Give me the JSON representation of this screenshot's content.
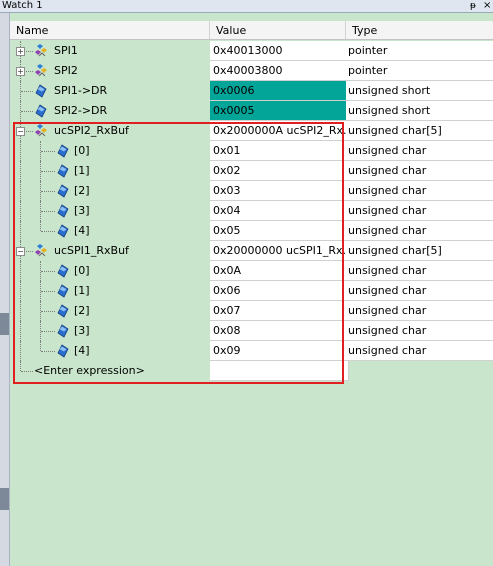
{
  "window": {
    "title": "Watch 1",
    "pin_icon": "pin-icon",
    "close_icon": "close-icon",
    "pin_glyph": "ᵽ",
    "close_glyph": "×"
  },
  "columns": {
    "name": "Name",
    "value": "Value",
    "type": "Type"
  },
  "rows": [
    {
      "name": "SPI1",
      "value": "0x40013000",
      "type": "pointer",
      "icon": "struct-icon",
      "expander": "+"
    },
    {
      "name": "SPI2",
      "value": "0x40003800",
      "type": "pointer",
      "icon": "struct-icon",
      "expander": "+"
    },
    {
      "name": "SPI1->DR",
      "value": "0x0006",
      "type": "unsigned short",
      "icon": "variable-icon",
      "highlight": true
    },
    {
      "name": "SPI2->DR",
      "value": "0x0005",
      "type": "unsigned short",
      "icon": "variable-icon",
      "highlight": true
    },
    {
      "name": "ucSPI2_RxBuf",
      "value": "0x2000000A ucSPI2_Rx...",
      "type": "unsigned char[5]",
      "icon": "struct-icon",
      "expander": "−"
    },
    {
      "name": "[0]",
      "value": "0x01",
      "type": "unsigned char",
      "icon": "variable-icon"
    },
    {
      "name": "[1]",
      "value": "0x02",
      "type": "unsigned char",
      "icon": "variable-icon"
    },
    {
      "name": "[2]",
      "value": "0x03",
      "type": "unsigned char",
      "icon": "variable-icon"
    },
    {
      "name": "[3]",
      "value": "0x04",
      "type": "unsigned char",
      "icon": "variable-icon"
    },
    {
      "name": "[4]",
      "value": "0x05",
      "type": "unsigned char",
      "icon": "variable-icon"
    },
    {
      "name": "ucSPI1_RxBuf",
      "value": "0x20000000 ucSPI1_Rx...",
      "type": "unsigned char[5]",
      "icon": "struct-icon",
      "expander": "−"
    },
    {
      "name": "[0]",
      "value": "0x0A",
      "type": "unsigned char",
      "icon": "variable-icon"
    },
    {
      "name": "[1]",
      "value": "0x06",
      "type": "unsigned char",
      "icon": "variable-icon"
    },
    {
      "name": "[2]",
      "value": "0x07",
      "type": "unsigned char",
      "icon": "variable-icon"
    },
    {
      "name": "[3]",
      "value": "0x08",
      "type": "unsigned char",
      "icon": "variable-icon"
    },
    {
      "name": "[4]",
      "value": "0x09",
      "type": "unsigned char",
      "icon": "variable-icon"
    }
  ],
  "enter_expression": "<Enter expression>",
  "colors": {
    "highlight": "#02a597",
    "annotation": "#e02020",
    "background": "#c9e6cc"
  }
}
